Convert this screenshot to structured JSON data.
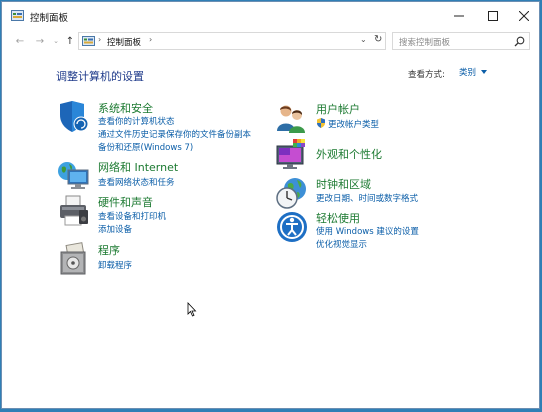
{
  "window": {
    "title": "控制面板"
  },
  "titlebar": {
    "minimize": "—",
    "maximize": "☐",
    "close": "✕"
  },
  "nav": {
    "back": "←",
    "forward": "→",
    "recent": "⌄",
    "up": "↑",
    "crumb": "控制面板",
    "sep1": "›",
    "sep2": "›",
    "dropdown": "⌄",
    "refresh": "↻",
    "search_placeholder": "搜索控制面板"
  },
  "main": {
    "title": "调整计算机的设置",
    "view_by_label": "查看方式:",
    "view_by_value": "类别"
  },
  "categories": {
    "system": {
      "title": "系统和安全",
      "links": [
        "查看你的计算机状态",
        "通过文件历史记录保存你的文件备份副本",
        "备份和还原(Windows 7)"
      ]
    },
    "network": {
      "title": "网络和 Internet",
      "links": [
        "查看网络状态和任务"
      ]
    },
    "hardware": {
      "title": "硬件和声音",
      "links": [
        "查看设备和打印机",
        "添加设备"
      ]
    },
    "programs": {
      "title": "程序",
      "links": [
        "卸载程序"
      ]
    },
    "users": {
      "title": "用户帐户",
      "links": [
        "更改帐户类型"
      ]
    },
    "appearance": {
      "title": "外观和个性化",
      "links": []
    },
    "clock": {
      "title": "时钟和区域",
      "links": [
        "更改日期、时间或数字格式"
      ]
    },
    "ease": {
      "title": "轻松使用",
      "links": [
        "使用 Windows 建议的设置",
        "优化视觉显示"
      ]
    }
  }
}
